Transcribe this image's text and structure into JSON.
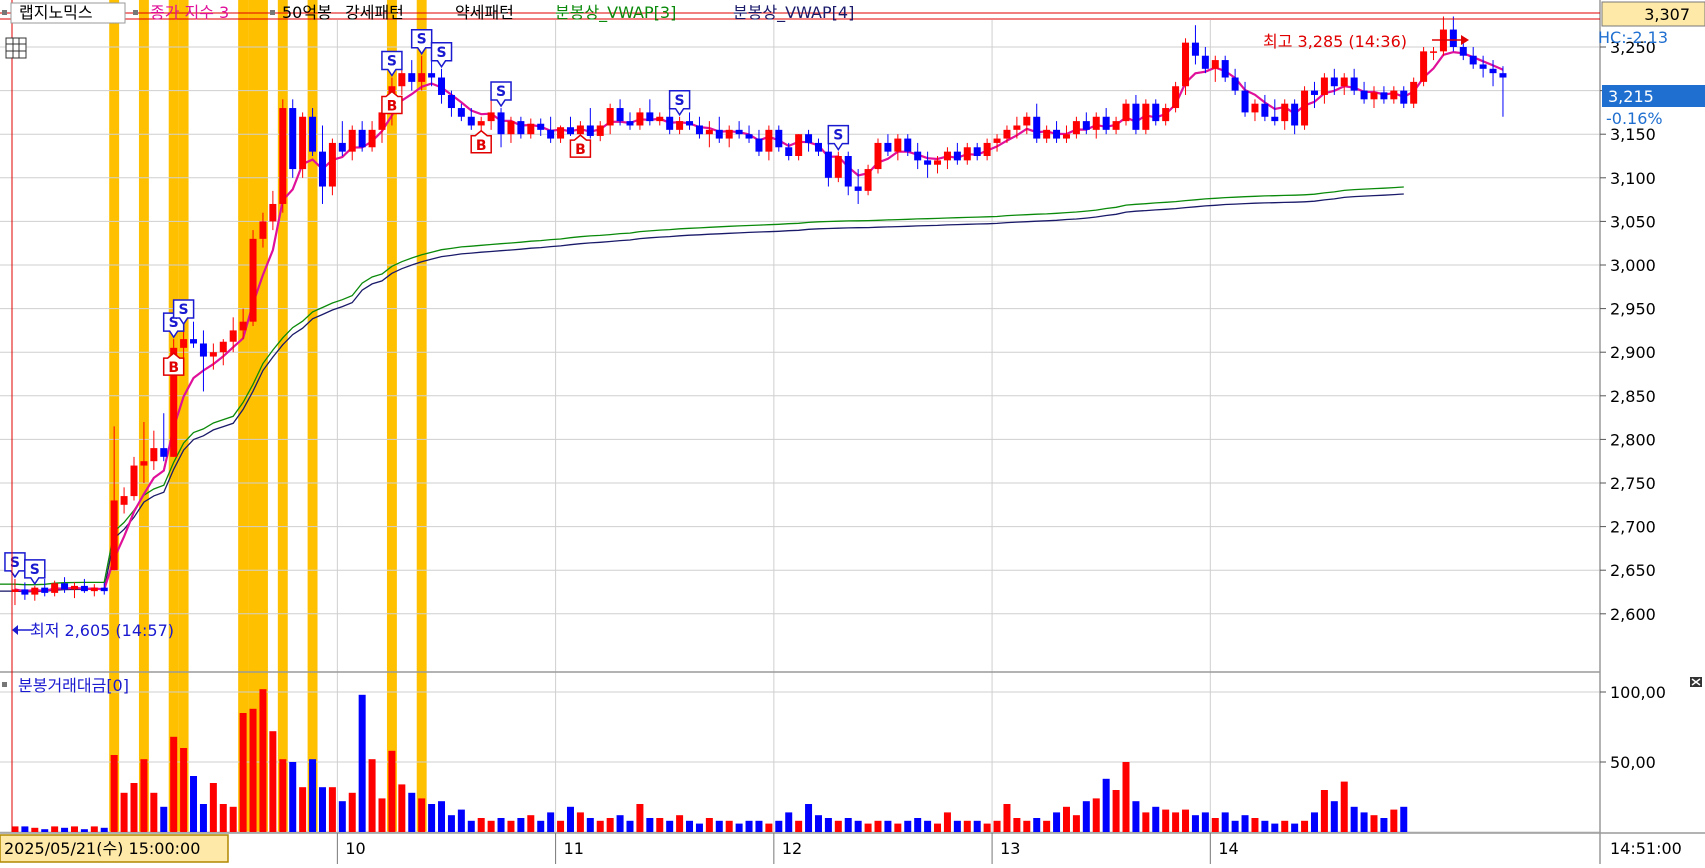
{
  "legend": {
    "items": [
      {
        "label": "랩지노믹스",
        "color": "#000000"
      },
      {
        "label": "종가 지수 3",
        "color": "#e0109a"
      },
      {
        "label": "50억봉",
        "color": "#000000"
      },
      {
        "label": "강세패턴",
        "color": "#000000"
      },
      {
        "label": "약세패턴",
        "color": "#000000"
      },
      {
        "label": "분봉상_VWAP[3]",
        "color": "#0a8a0a"
      },
      {
        "label": "분봉상_VWAP[4]",
        "color": "#1a1a6a"
      }
    ],
    "volume_label": "분봉거래대금[0]"
  },
  "price_axis": {
    "ticks": [
      "3,250",
      "3,200",
      "3,150",
      "3,100",
      "3,050",
      "3,000",
      "2,950",
      "2,900",
      "2,850",
      "2,800",
      "2,750",
      "2,700",
      "2,650",
      "2,600"
    ],
    "top_value": "3,307",
    "current_value": "3,215",
    "current_change": "-0.16%",
    "hc_label": "HC:-2.13"
  },
  "volume_axis": {
    "ticks": [
      "100,00",
      "50,00"
    ]
  },
  "time_axis": {
    "start_label": "2025/05/21(수) 15:00:00",
    "day_labels": [
      "10",
      "11",
      "12",
      "13",
      "14"
    ],
    "cursor_time": "14:51:00"
  },
  "annotations": {
    "high": "최고 3,285 (14:36)",
    "low": "최저 2,605 (14:57)"
  },
  "colors": {
    "up": "#ff0000",
    "down": "#0000ff",
    "ma": "#e0109a",
    "vwap3": "#0a8a0a",
    "vwap4": "#1a1a6a",
    "highlight": "#ffc000",
    "grid": "#cfcfcf",
    "accent_blue": "#1f6fd0"
  },
  "chart_data": {
    "type": "candlestick",
    "y_range": [
      2575,
      3307
    ],
    "volume_range": [
      0,
      115
    ],
    "candles": [
      {
        "o": 2625,
        "h": 2640,
        "l": 2610,
        "c": 2628
      },
      {
        "o": 2628,
        "h": 2636,
        "l": 2616,
        "c": 2622
      },
      {
        "o": 2622,
        "h": 2632,
        "l": 2615,
        "c": 2630
      },
      {
        "o": 2630,
        "h": 2640,
        "l": 2620,
        "c": 2624
      },
      {
        "o": 2624,
        "h": 2638,
        "l": 2620,
        "c": 2635
      },
      {
        "o": 2635,
        "h": 2642,
        "l": 2624,
        "c": 2628
      },
      {
        "o": 2628,
        "h": 2636,
        "l": 2618,
        "c": 2632
      },
      {
        "o": 2632,
        "h": 2640,
        "l": 2624,
        "c": 2626
      },
      {
        "o": 2626,
        "h": 2634,
        "l": 2620,
        "c": 2630
      },
      {
        "o": 2630,
        "h": 2636,
        "l": 2622,
        "c": 2626
      },
      {
        "o": 2650,
        "h": 2815,
        "l": 2650,
        "c": 2730
      },
      {
        "o": 2725,
        "h": 2745,
        "l": 2715,
        "c": 2735
      },
      {
        "o": 2735,
        "h": 2780,
        "l": 2730,
        "c": 2770
      },
      {
        "o": 2770,
        "h": 2820,
        "l": 2750,
        "c": 2775
      },
      {
        "o": 2775,
        "h": 2810,
        "l": 2765,
        "c": 2790
      },
      {
        "o": 2790,
        "h": 2830,
        "l": 2775,
        "c": 2780
      },
      {
        "o": 2780,
        "h": 2915,
        "l": 2780,
        "c": 2905
      },
      {
        "o": 2905,
        "h": 2930,
        "l": 2880,
        "c": 2915
      },
      {
        "o": 2915,
        "h": 2935,
        "l": 2905,
        "c": 2910
      },
      {
        "o": 2910,
        "h": 2925,
        "l": 2855,
        "c": 2895
      },
      {
        "o": 2895,
        "h": 2910,
        "l": 2880,
        "c": 2900
      },
      {
        "o": 2900,
        "h": 2915,
        "l": 2885,
        "c": 2912
      },
      {
        "o": 2912,
        "h": 2940,
        "l": 2900,
        "c": 2925
      },
      {
        "o": 2925,
        "h": 2950,
        "l": 2915,
        "c": 2935
      },
      {
        "o": 2935,
        "h": 3040,
        "l": 2930,
        "c": 3030
      },
      {
        "o": 3030,
        "h": 3060,
        "l": 3020,
        "c": 3050
      },
      {
        "o": 3050,
        "h": 3085,
        "l": 3040,
        "c": 3070
      },
      {
        "o": 3070,
        "h": 3190,
        "l": 3060,
        "c": 3180
      },
      {
        "o": 3180,
        "h": 3190,
        "l": 3100,
        "c": 3110
      },
      {
        "o": 3110,
        "h": 3175,
        "l": 3100,
        "c": 3170
      },
      {
        "o": 3170,
        "h": 3180,
        "l": 3125,
        "c": 3130
      },
      {
        "o": 3130,
        "h": 3160,
        "l": 3070,
        "c": 3090
      },
      {
        "o": 3090,
        "h": 3145,
        "l": 3080,
        "c": 3140
      },
      {
        "o": 3140,
        "h": 3165,
        "l": 3125,
        "c": 3130
      },
      {
        "o": 3130,
        "h": 3160,
        "l": 3120,
        "c": 3155
      },
      {
        "o": 3155,
        "h": 3165,
        "l": 3130,
        "c": 3135
      },
      {
        "o": 3135,
        "h": 3165,
        "l": 3130,
        "c": 3155
      },
      {
        "o": 3155,
        "h": 3185,
        "l": 3140,
        "c": 3175
      },
      {
        "o": 3175,
        "h": 3215,
        "l": 3160,
        "c": 3205
      },
      {
        "o": 3205,
        "h": 3225,
        "l": 3195,
        "c": 3220
      },
      {
        "o": 3220,
        "h": 3235,
        "l": 3200,
        "c": 3210
      },
      {
        "o": 3210,
        "h": 3240,
        "l": 3200,
        "c": 3220
      },
      {
        "o": 3220,
        "h": 3260,
        "l": 3205,
        "c": 3215
      },
      {
        "o": 3215,
        "h": 3225,
        "l": 3185,
        "c": 3195
      },
      {
        "o": 3195,
        "h": 3200,
        "l": 3170,
        "c": 3180
      },
      {
        "o": 3180,
        "h": 3185,
        "l": 3165,
        "c": 3170
      },
      {
        "o": 3170,
        "h": 3180,
        "l": 3155,
        "c": 3160
      },
      {
        "o": 3160,
        "h": 3170,
        "l": 3150,
        "c": 3165
      },
      {
        "o": 3165,
        "h": 3190,
        "l": 3155,
        "c": 3175
      },
      {
        "o": 3175,
        "h": 3180,
        "l": 3135,
        "c": 3150
      },
      {
        "o": 3150,
        "h": 3170,
        "l": 3140,
        "c": 3165
      },
      {
        "o": 3165,
        "h": 3170,
        "l": 3145,
        "c": 3150
      },
      {
        "o": 3150,
        "h": 3168,
        "l": 3145,
        "c": 3162
      },
      {
        "o": 3162,
        "h": 3168,
        "l": 3148,
        "c": 3155
      },
      {
        "o": 3155,
        "h": 3170,
        "l": 3140,
        "c": 3145
      },
      {
        "o": 3145,
        "h": 3160,
        "l": 3140,
        "c": 3158
      },
      {
        "o": 3158,
        "h": 3170,
        "l": 3148,
        "c": 3150
      },
      {
        "o": 3150,
        "h": 3165,
        "l": 3140,
        "c": 3160
      },
      {
        "o": 3160,
        "h": 3180,
        "l": 3145,
        "c": 3148
      },
      {
        "o": 3148,
        "h": 3165,
        "l": 3142,
        "c": 3160
      },
      {
        "o": 3160,
        "h": 3185,
        "l": 3150,
        "c": 3180
      },
      {
        "o": 3180,
        "h": 3190,
        "l": 3160,
        "c": 3165
      },
      {
        "o": 3165,
        "h": 3175,
        "l": 3155,
        "c": 3160
      },
      {
        "o": 3160,
        "h": 3180,
        "l": 3155,
        "c": 3175
      },
      {
        "o": 3175,
        "h": 3190,
        "l": 3160,
        "c": 3165
      },
      {
        "o": 3165,
        "h": 3175,
        "l": 3160,
        "c": 3170
      },
      {
        "o": 3170,
        "h": 3180,
        "l": 3150,
        "c": 3155
      },
      {
        "o": 3155,
        "h": 3170,
        "l": 3150,
        "c": 3165
      },
      {
        "o": 3165,
        "h": 3175,
        "l": 3155,
        "c": 3160
      },
      {
        "o": 3160,
        "h": 3170,
        "l": 3145,
        "c": 3150
      },
      {
        "o": 3150,
        "h": 3165,
        "l": 3135,
        "c": 3155
      },
      {
        "o": 3155,
        "h": 3170,
        "l": 3140,
        "c": 3145
      },
      {
        "o": 3145,
        "h": 3160,
        "l": 3135,
        "c": 3155
      },
      {
        "o": 3155,
        "h": 3165,
        "l": 3145,
        "c": 3150
      },
      {
        "o": 3150,
        "h": 3160,
        "l": 3140,
        "c": 3145
      },
      {
        "o": 3145,
        "h": 3155,
        "l": 3125,
        "c": 3130
      },
      {
        "o": 3130,
        "h": 3160,
        "l": 3120,
        "c": 3155
      },
      {
        "o": 3155,
        "h": 3160,
        "l": 3130,
        "c": 3135
      },
      {
        "o": 3135,
        "h": 3140,
        "l": 3120,
        "c": 3125
      },
      {
        "o": 3125,
        "h": 3150,
        "l": 3120,
        "c": 3150
      },
      {
        "o": 3150,
        "h": 3155,
        "l": 3130,
        "c": 3140
      },
      {
        "o": 3140,
        "h": 3145,
        "l": 3125,
        "c": 3130
      },
      {
        "o": 3130,
        "h": 3140,
        "l": 3090,
        "c": 3100
      },
      {
        "o": 3100,
        "h": 3130,
        "l": 3095,
        "c": 3125
      },
      {
        "o": 3125,
        "h": 3130,
        "l": 3080,
        "c": 3090
      },
      {
        "o": 3090,
        "h": 3110,
        "l": 3070,
        "c": 3085
      },
      {
        "o": 3085,
        "h": 3115,
        "l": 3080,
        "c": 3110
      },
      {
        "o": 3110,
        "h": 3145,
        "l": 3105,
        "c": 3140
      },
      {
        "o": 3140,
        "h": 3150,
        "l": 3125,
        "c": 3130
      },
      {
        "o": 3130,
        "h": 3150,
        "l": 3120,
        "c": 3145
      },
      {
        "o": 3145,
        "h": 3150,
        "l": 3125,
        "c": 3130
      },
      {
        "o": 3130,
        "h": 3140,
        "l": 3110,
        "c": 3120
      },
      {
        "o": 3120,
        "h": 3130,
        "l": 3100,
        "c": 3115
      },
      {
        "o": 3115,
        "h": 3125,
        "l": 3105,
        "c": 3120
      },
      {
        "o": 3120,
        "h": 3135,
        "l": 3110,
        "c": 3130
      },
      {
        "o": 3130,
        "h": 3140,
        "l": 3115,
        "c": 3120
      },
      {
        "o": 3120,
        "h": 3140,
        "l": 3115,
        "c": 3135
      },
      {
        "o": 3135,
        "h": 3140,
        "l": 3120,
        "c": 3125
      },
      {
        "o": 3125,
        "h": 3145,
        "l": 3120,
        "c": 3140
      },
      {
        "o": 3140,
        "h": 3150,
        "l": 3130,
        "c": 3145
      },
      {
        "o": 3145,
        "h": 3160,
        "l": 3140,
        "c": 3155
      },
      {
        "o": 3155,
        "h": 3170,
        "l": 3145,
        "c": 3160
      },
      {
        "o": 3160,
        "h": 3175,
        "l": 3150,
        "c": 3170
      },
      {
        "o": 3170,
        "h": 3185,
        "l": 3140,
        "c": 3145
      },
      {
        "o": 3145,
        "h": 3160,
        "l": 3140,
        "c": 3155
      },
      {
        "o": 3155,
        "h": 3165,
        "l": 3140,
        "c": 3145
      },
      {
        "o": 3145,
        "h": 3160,
        "l": 3140,
        "c": 3150
      },
      {
        "o": 3150,
        "h": 3170,
        "l": 3145,
        "c": 3165
      },
      {
        "o": 3165,
        "h": 3175,
        "l": 3150,
        "c": 3155
      },
      {
        "o": 3155,
        "h": 3175,
        "l": 3145,
        "c": 3170
      },
      {
        "o": 3170,
        "h": 3180,
        "l": 3150,
        "c": 3155
      },
      {
        "o": 3155,
        "h": 3170,
        "l": 3150,
        "c": 3165
      },
      {
        "o": 3165,
        "h": 3190,
        "l": 3160,
        "c": 3185
      },
      {
        "o": 3185,
        "h": 3195,
        "l": 3150,
        "c": 3155
      },
      {
        "o": 3155,
        "h": 3190,
        "l": 3150,
        "c": 3185
      },
      {
        "o": 3185,
        "h": 3190,
        "l": 3160,
        "c": 3165
      },
      {
        "o": 3165,
        "h": 3185,
        "l": 3160,
        "c": 3180
      },
      {
        "o": 3180,
        "h": 3210,
        "l": 3175,
        "c": 3205
      },
      {
        "o": 3205,
        "h": 3260,
        "l": 3195,
        "c": 3255
      },
      {
        "o": 3255,
        "h": 3275,
        "l": 3230,
        "c": 3240
      },
      {
        "o": 3240,
        "h": 3250,
        "l": 3220,
        "c": 3225
      },
      {
        "o": 3225,
        "h": 3240,
        "l": 3210,
        "c": 3235
      },
      {
        "o": 3235,
        "h": 3240,
        "l": 3210,
        "c": 3215
      },
      {
        "o": 3215,
        "h": 3225,
        "l": 3195,
        "c": 3200
      },
      {
        "o": 3200,
        "h": 3210,
        "l": 3170,
        "c": 3175
      },
      {
        "o": 3175,
        "h": 3190,
        "l": 3165,
        "c": 3185
      },
      {
        "o": 3185,
        "h": 3195,
        "l": 3165,
        "c": 3170
      },
      {
        "o": 3170,
        "h": 3190,
        "l": 3160,
        "c": 3165
      },
      {
        "o": 3165,
        "h": 3190,
        "l": 3155,
        "c": 3185
      },
      {
        "o": 3185,
        "h": 3190,
        "l": 3150,
        "c": 3160
      },
      {
        "o": 3160,
        "h": 3205,
        "l": 3155,
        "c": 3200
      },
      {
        "o": 3200,
        "h": 3210,
        "l": 3180,
        "c": 3195
      },
      {
        "o": 3195,
        "h": 3220,
        "l": 3185,
        "c": 3215
      },
      {
        "o": 3215,
        "h": 3225,
        "l": 3195,
        "c": 3205
      },
      {
        "o": 3205,
        "h": 3220,
        "l": 3195,
        "c": 3215
      },
      {
        "o": 3215,
        "h": 3225,
        "l": 3195,
        "c": 3200
      },
      {
        "o": 3200,
        "h": 3210,
        "l": 3185,
        "c": 3190
      },
      {
        "o": 3190,
        "h": 3205,
        "l": 3180,
        "c": 3198
      },
      {
        "o": 3198,
        "h": 3205,
        "l": 3185,
        "c": 3190
      },
      {
        "o": 3190,
        "h": 3205,
        "l": 3185,
        "c": 3200
      },
      {
        "o": 3200,
        "h": 3205,
        "l": 3180,
        "c": 3185
      },
      {
        "o": 3185,
        "h": 3215,
        "l": 3180,
        "c": 3210
      },
      {
        "o": 3210,
        "h": 3250,
        "l": 3205,
        "c": 3245
      },
      {
        "o": 3245,
        "h": 3250,
        "l": 3235,
        "c": 3245
      },
      {
        "o": 3245,
        "h": 3285,
        "l": 3240,
        "c": 3270
      },
      {
        "o": 3270,
        "h": 3285,
        "l": 3245,
        "c": 3250
      },
      {
        "o": 3250,
        "h": 3260,
        "l": 3235,
        "c": 3240
      },
      {
        "o": 3240,
        "h": 3250,
        "l": 3225,
        "c": 3230
      },
      {
        "o": 3230,
        "h": 3240,
        "l": 3215,
        "c": 3225
      },
      {
        "o": 3225,
        "h": 3235,
        "l": 3205,
        "c": 3220
      },
      {
        "o": 3220,
        "h": 3228,
        "l": 3170,
        "c": 3215
      }
    ],
    "volumes": [
      4,
      4,
      3,
      2,
      4,
      3,
      4,
      2,
      4,
      3,
      55,
      28,
      35,
      52,
      28,
      18,
      68,
      60,
      40,
      20,
      35,
      20,
      18,
      85,
      88,
      102,
      72,
      52,
      50,
      32,
      52,
      32,
      32,
      22,
      28,
      98,
      52,
      24,
      58,
      34,
      28,
      24,
      20,
      22,
      12,
      16,
      8,
      10,
      8,
      10,
      8,
      10,
      12,
      8,
      14,
      8,
      18,
      14,
      10,
      8,
      10,
      12,
      8,
      20,
      10,
      10,
      8,
      12,
      8,
      6,
      10,
      8,
      8,
      6,
      8,
      8,
      6,
      8,
      14,
      8,
      20,
      12,
      10,
      8,
      10,
      8,
      6,
      8,
      8,
      6,
      8,
      10,
      8,
      6,
      14,
      8,
      8,
      8,
      6,
      8,
      20,
      10,
      8,
      10,
      8,
      14,
      18,
      12,
      22,
      24,
      38,
      30,
      50,
      22,
      14,
      18,
      16,
      14,
      16,
      12,
      14,
      10,
      14,
      8,
      12,
      10,
      8,
      6,
      8,
      6,
      8,
      14,
      30,
      22,
      36,
      18,
      14,
      12,
      10,
      16,
      18
    ],
    "highlight_candles": [
      10,
      13,
      16,
      17,
      23,
      24,
      25,
      27,
      30,
      38,
      41
    ],
    "signals": [
      {
        "i": 0,
        "t": "S"
      },
      {
        "i": 2,
        "t": "S"
      },
      {
        "i": 16,
        "t": "S"
      },
      {
        "i": 16,
        "t": "B"
      },
      {
        "i": 17,
        "t": "S"
      },
      {
        "i": 38,
        "t": "S"
      },
      {
        "i": 38,
        "t": "B"
      },
      {
        "i": 41,
        "t": "S"
      },
      {
        "i": 43,
        "t": "S"
      },
      {
        "i": 47,
        "t": "B"
      },
      {
        "i": 49,
        "t": "S"
      },
      {
        "i": 57,
        "t": "B"
      },
      {
        "i": 67,
        "t": "S"
      },
      {
        "i": 83,
        "t": "S"
      }
    ]
  }
}
